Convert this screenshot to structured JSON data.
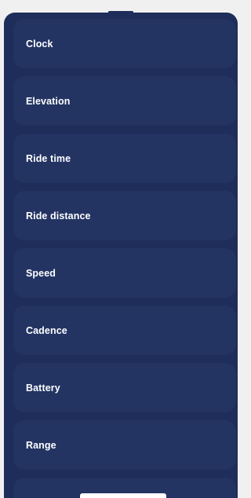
{
  "colors": {
    "background": "#f0f0f0",
    "sheet": "#1e2d59",
    "item": "#233463",
    "text": "#ffffff"
  },
  "list": {
    "items": [
      {
        "label": "Clock"
      },
      {
        "label": "Elevation"
      },
      {
        "label": "Ride time"
      },
      {
        "label": "Ride distance"
      },
      {
        "label": "Speed"
      },
      {
        "label": "Cadence"
      },
      {
        "label": "Battery"
      },
      {
        "label": "Range"
      }
    ]
  }
}
